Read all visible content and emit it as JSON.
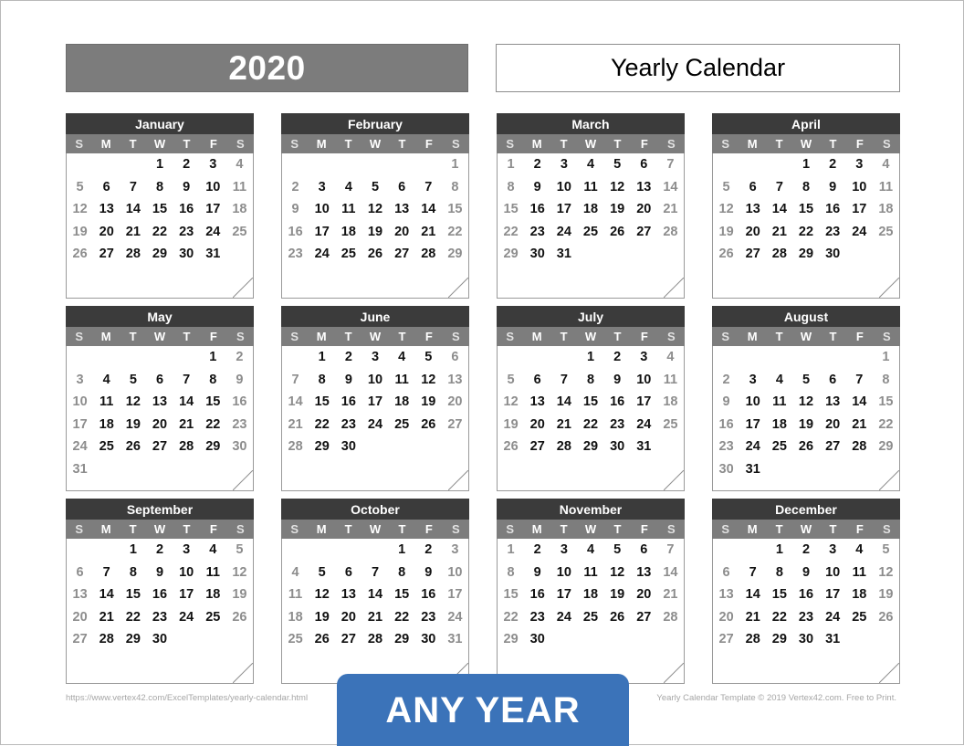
{
  "header": {
    "year": "2020",
    "title": "Yearly Calendar"
  },
  "weekday_labels": [
    "S",
    "M",
    "T",
    "W",
    "T",
    "F",
    "S"
  ],
  "calendar": {
    "months": [
      {
        "name": "January",
        "weeks": [
          [
            "",
            "",
            "",
            "1",
            "2",
            "3",
            "4"
          ],
          [
            "5",
            "6",
            "7",
            "8",
            "9",
            "10",
            "11"
          ],
          [
            "12",
            "13",
            "14",
            "15",
            "16",
            "17",
            "18"
          ],
          [
            "19",
            "20",
            "21",
            "22",
            "23",
            "24",
            "25"
          ],
          [
            "26",
            "27",
            "28",
            "29",
            "30",
            "31",
            ""
          ],
          [
            "",
            "",
            "",
            "",
            "",
            "",
            ""
          ]
        ]
      },
      {
        "name": "February",
        "weeks": [
          [
            "",
            "",
            "",
            "",
            "",
            "",
            "1"
          ],
          [
            "2",
            "3",
            "4",
            "5",
            "6",
            "7",
            "8"
          ],
          [
            "9",
            "10",
            "11",
            "12",
            "13",
            "14",
            "15"
          ],
          [
            "16",
            "17",
            "18",
            "19",
            "20",
            "21",
            "22"
          ],
          [
            "23",
            "24",
            "25",
            "26",
            "27",
            "28",
            "29"
          ],
          [
            "",
            "",
            "",
            "",
            "",
            "",
            ""
          ]
        ]
      },
      {
        "name": "March",
        "weeks": [
          [
            "1",
            "2",
            "3",
            "4",
            "5",
            "6",
            "7"
          ],
          [
            "8",
            "9",
            "10",
            "11",
            "12",
            "13",
            "14"
          ],
          [
            "15",
            "16",
            "17",
            "18",
            "19",
            "20",
            "21"
          ],
          [
            "22",
            "23",
            "24",
            "25",
            "26",
            "27",
            "28"
          ],
          [
            "29",
            "30",
            "31",
            "",
            "",
            "",
            ""
          ],
          [
            "",
            "",
            "",
            "",
            "",
            "",
            ""
          ]
        ]
      },
      {
        "name": "April",
        "weeks": [
          [
            "",
            "",
            "",
            "1",
            "2",
            "3",
            "4"
          ],
          [
            "5",
            "6",
            "7",
            "8",
            "9",
            "10",
            "11"
          ],
          [
            "12",
            "13",
            "14",
            "15",
            "16",
            "17",
            "18"
          ],
          [
            "19",
            "20",
            "21",
            "22",
            "23",
            "24",
            "25"
          ],
          [
            "26",
            "27",
            "28",
            "29",
            "30",
            "",
            ""
          ],
          [
            "",
            "",
            "",
            "",
            "",
            "",
            ""
          ]
        ]
      },
      {
        "name": "May",
        "weeks": [
          [
            "",
            "",
            "",
            "",
            "",
            "1",
            "2"
          ],
          [
            "3",
            "4",
            "5",
            "6",
            "7",
            "8",
            "9"
          ],
          [
            "10",
            "11",
            "12",
            "13",
            "14",
            "15",
            "16"
          ],
          [
            "17",
            "18",
            "19",
            "20",
            "21",
            "22",
            "23"
          ],
          [
            "24",
            "25",
            "26",
            "27",
            "28",
            "29",
            "30"
          ],
          [
            "31",
            "",
            "",
            "",
            "",
            "",
            ""
          ]
        ]
      },
      {
        "name": "June",
        "weeks": [
          [
            "",
            "1",
            "2",
            "3",
            "4",
            "5",
            "6"
          ],
          [
            "7",
            "8",
            "9",
            "10",
            "11",
            "12",
            "13"
          ],
          [
            "14",
            "15",
            "16",
            "17",
            "18",
            "19",
            "20"
          ],
          [
            "21",
            "22",
            "23",
            "24",
            "25",
            "26",
            "27"
          ],
          [
            "28",
            "29",
            "30",
            "",
            "",
            "",
            ""
          ],
          [
            "",
            "",
            "",
            "",
            "",
            "",
            ""
          ]
        ]
      },
      {
        "name": "July",
        "weeks": [
          [
            "",
            "",
            "",
            "1",
            "2",
            "3",
            "4"
          ],
          [
            "5",
            "6",
            "7",
            "8",
            "9",
            "10",
            "11"
          ],
          [
            "12",
            "13",
            "14",
            "15",
            "16",
            "17",
            "18"
          ],
          [
            "19",
            "20",
            "21",
            "22",
            "23",
            "24",
            "25"
          ],
          [
            "26",
            "27",
            "28",
            "29",
            "30",
            "31",
            ""
          ],
          [
            "",
            "",
            "",
            "",
            "",
            "",
            ""
          ]
        ]
      },
      {
        "name": "August",
        "weeks": [
          [
            "",
            "",
            "",
            "",
            "",
            "",
            "1"
          ],
          [
            "2",
            "3",
            "4",
            "5",
            "6",
            "7",
            "8"
          ],
          [
            "9",
            "10",
            "11",
            "12",
            "13",
            "14",
            "15"
          ],
          [
            "16",
            "17",
            "18",
            "19",
            "20",
            "21",
            "22"
          ],
          [
            "23",
            "24",
            "25",
            "26",
            "27",
            "28",
            "29"
          ],
          [
            "30",
            "31",
            "",
            "",
            "",
            "",
            ""
          ]
        ]
      },
      {
        "name": "September",
        "weeks": [
          [
            "",
            "",
            "1",
            "2",
            "3",
            "4",
            "5"
          ],
          [
            "6",
            "7",
            "8",
            "9",
            "10",
            "11",
            "12"
          ],
          [
            "13",
            "14",
            "15",
            "16",
            "17",
            "18",
            "19"
          ],
          [
            "20",
            "21",
            "22",
            "23",
            "24",
            "25",
            "26"
          ],
          [
            "27",
            "28",
            "29",
            "30",
            "",
            "",
            ""
          ],
          [
            "",
            "",
            "",
            "",
            "",
            "",
            ""
          ]
        ]
      },
      {
        "name": "October",
        "weeks": [
          [
            "",
            "",
            "",
            "",
            "1",
            "2",
            "3"
          ],
          [
            "4",
            "5",
            "6",
            "7",
            "8",
            "9",
            "10"
          ],
          [
            "11",
            "12",
            "13",
            "14",
            "15",
            "16",
            "17"
          ],
          [
            "18",
            "19",
            "20",
            "21",
            "22",
            "23",
            "24"
          ],
          [
            "25",
            "26",
            "27",
            "28",
            "29",
            "30",
            "31"
          ],
          [
            "",
            "",
            "",
            "",
            "",
            "",
            ""
          ]
        ]
      },
      {
        "name": "November",
        "weeks": [
          [
            "1",
            "2",
            "3",
            "4",
            "5",
            "6",
            "7"
          ],
          [
            "8",
            "9",
            "10",
            "11",
            "12",
            "13",
            "14"
          ],
          [
            "15",
            "16",
            "17",
            "18",
            "19",
            "20",
            "21"
          ],
          [
            "22",
            "23",
            "24",
            "25",
            "26",
            "27",
            "28"
          ],
          [
            "29",
            "30",
            "",
            "",
            "",
            "",
            ""
          ],
          [
            "",
            "",
            "",
            "",
            "",
            "",
            ""
          ]
        ]
      },
      {
        "name": "December",
        "weeks": [
          [
            "",
            "",
            "1",
            "2",
            "3",
            "4",
            "5"
          ],
          [
            "6",
            "7",
            "8",
            "9",
            "10",
            "11",
            "12"
          ],
          [
            "13",
            "14",
            "15",
            "16",
            "17",
            "18",
            "19"
          ],
          [
            "20",
            "21",
            "22",
            "23",
            "24",
            "25",
            "26"
          ],
          [
            "27",
            "28",
            "29",
            "30",
            "31",
            "",
            ""
          ],
          [
            "",
            "",
            "",
            "",
            "",
            "",
            ""
          ]
        ]
      }
    ]
  },
  "footer": {
    "left": "https://www.vertex42.com/ExcelTemplates/yearly-calendar.html",
    "right": "Yearly Calendar Template © 2019 Vertex42.com. Free to Print."
  },
  "banner": {
    "label": "ANY YEAR"
  },
  "colors": {
    "month_header": "#3b3b3b",
    "dow_header": "#7d7d7d",
    "year_box": "#7c7c7c",
    "banner": "#3b73b9",
    "weekend_text": "#8d8d8d",
    "weekday_text": "#111111"
  }
}
